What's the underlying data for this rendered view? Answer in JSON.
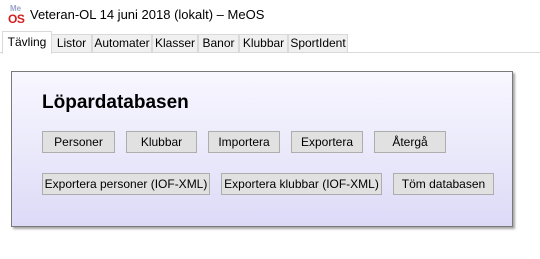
{
  "window": {
    "title": "Veteran-OL 14 juni 2018 (lokalt) – MeOS",
    "icon": {
      "top_text": "Me",
      "bottom_text": "OS",
      "name": "meos-logo-icon"
    }
  },
  "tabs": [
    {
      "label": "Tävling",
      "active": true
    },
    {
      "label": "Listor"
    },
    {
      "label": "Automater"
    },
    {
      "label": "Klasser"
    },
    {
      "label": "Banor"
    },
    {
      "label": "Klubbar"
    },
    {
      "label": "SportIdent"
    }
  ],
  "panel": {
    "title": "Löpardatabasen",
    "row1": [
      "Personer",
      "Klubbar",
      "Importera",
      "Exportera",
      "Återgå"
    ],
    "row2": [
      "Exportera personer (IOF-XML)",
      "Exportera klubbar (IOF-XML)",
      "Töm databasen"
    ]
  },
  "colors": {
    "panel_gradient_top": "#f8f7ff",
    "panel_gradient_bottom": "#dcdaf7",
    "logo_red": "#d21f1f"
  }
}
